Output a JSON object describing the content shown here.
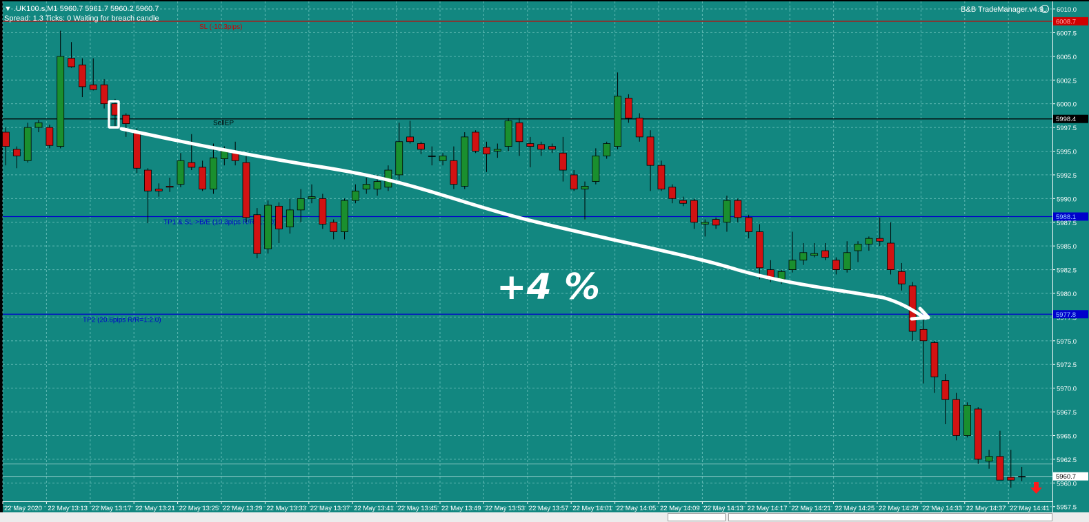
{
  "header": {
    "symbol_line": ".UK100.s,M1  5960.7 5961.7 5960.2 5960.7",
    "status_line": "Spread: 1.3   Ticks: 0   Waiting for breach candle",
    "trade_manager": "B&B TradeManager.v4.9"
  },
  "colors": {
    "background": "#128780",
    "grid": "#5fb9b3",
    "bull_candle": "#1a8f2e",
    "bear_candle": "#d21212",
    "stop_loss_line": "#d00000",
    "target_line": "#0000cc",
    "entry_line": "#000000"
  },
  "annotation": {
    "text": "+4 %",
    "arrow": "white hand-drawn arrow"
  },
  "chart_data": {
    "type": "candlestick",
    "title": ".UK100.s,M1",
    "ylim": [
      5956.9,
      6010.8
    ],
    "ytick_labels": [
      "6010.0",
      "6007.5",
      "6005.0",
      "6002.5",
      "6000.0",
      "5997.5",
      "5995.0",
      "5992.5",
      "5990.0",
      "5987.5",
      "5985.0",
      "5982.5",
      "5980.0",
      "5977.5",
      "5975.0",
      "5972.5",
      "5970.0",
      "5967.5",
      "5965.0",
      "5962.5",
      "5960.0",
      "5957.5"
    ],
    "xtick_labels": [
      "22 May 2020",
      "22 May 13:13",
      "22 May 13:17",
      "22 May 13:21",
      "22 May 13:25",
      "22 May 13:29",
      "22 May 13:33",
      "22 May 13:37",
      "22 May 13:41",
      "22 May 13:45",
      "22 May 13:49",
      "22 May 13:53",
      "22 May 13:57",
      "22 May 14:01",
      "22 May 14:05",
      "22 May 14:09",
      "22 May 14:13",
      "22 May 14:17",
      "22 May 14:21",
      "22 May 14:25",
      "22 May 14:29",
      "22 May 14:33",
      "22 May 14:37",
      "22 May 14:41"
    ],
    "levels": [
      {
        "label": "SL (-10.3pips)",
        "price": 6008.7,
        "tag": "6008.7",
        "role": "stop_loss"
      },
      {
        "label": "SellEP",
        "price": 5998.4,
        "tag": "5998.4",
        "role": "entry"
      },
      {
        "label": "TP1 & SL->B/E (10.3pips R/R=1:1.0)",
        "price": 5988.1,
        "tag": "5988.1",
        "role": "tp1"
      },
      {
        "label": "TP2 (20.6pips R/R=1:2.0)",
        "price": 5977.8,
        "tag": "5977.8",
        "role": "tp2"
      }
    ],
    "bid_price": {
      "price": 5960.7,
      "tag": "5960.7"
    },
    "extra_price_line": 5962.0,
    "candles": [
      {
        "o": 5997.0,
        "h": 5997.5,
        "l": 5993.5,
        "c": 5995.5
      },
      {
        "o": 5995.2,
        "h": 5995.5,
        "l": 5993.2,
        "c": 5994.5
      },
      {
        "o": 5994.0,
        "h": 5998.0,
        "l": 5993.8,
        "c": 5997.5
      },
      {
        "o": 5997.5,
        "h": 5998.3,
        "l": 5997.0,
        "c": 5998.0
      },
      {
        "o": 5997.5,
        "h": 5997.8,
        "l": 5995.3,
        "c": 5995.6
      },
      {
        "o": 5995.5,
        "h": 6007.7,
        "l": 5995.3,
        "c": 6005.0
      },
      {
        "o": 6004.8,
        "h": 6006.5,
        "l": 6003.8,
        "c": 6003.9
      },
      {
        "o": 6004.1,
        "h": 6004.8,
        "l": 6000.7,
        "c": 6001.8
      },
      {
        "o": 6002.0,
        "h": 6004.8,
        "l": 6001.4,
        "c": 6001.5
      },
      {
        "o": 6002.0,
        "h": 6002.6,
        "l": 5999.5,
        "c": 6000.0
      },
      {
        "o": 6000.0,
        "h": 6000.5,
        "l": 5997.5,
        "c": 5998.8
      },
      {
        "o": 5998.8,
        "h": 5999.0,
        "l": 5996.5,
        "c": 5997.9
      },
      {
        "o": 5997.0,
        "h": 5997.4,
        "l": 5992.7,
        "c": 5993.2
      },
      {
        "o": 5993.0,
        "h": 5993.2,
        "l": 5987.4,
        "c": 5990.8
      },
      {
        "o": 5991.0,
        "h": 5991.6,
        "l": 5990.2,
        "c": 5990.8
      },
      {
        "o": 5991.3,
        "h": 5992.2,
        "l": 5990.7,
        "c": 5991.2
      },
      {
        "o": 5991.5,
        "h": 5994.8,
        "l": 5991.2,
        "c": 5994.0
      },
      {
        "o": 5993.8,
        "h": 5996.8,
        "l": 5993.0,
        "c": 5993.3
      },
      {
        "o": 5993.3,
        "h": 5994.0,
        "l": 5990.8,
        "c": 5991.0
      },
      {
        "o": 5991.0,
        "h": 5995.8,
        "l": 5990.5,
        "c": 5994.3
      },
      {
        "o": 5994.2,
        "h": 5995.5,
        "l": 5993.5,
        "c": 5995.0
      },
      {
        "o": 5995.0,
        "h": 5996.0,
        "l": 5993.5,
        "c": 5994.0
      },
      {
        "o": 5993.8,
        "h": 5994.5,
        "l": 5987.5,
        "c": 5988.0
      },
      {
        "o": 5988.3,
        "h": 5989.0,
        "l": 5983.7,
        "c": 5984.2
      },
      {
        "o": 5984.7,
        "h": 5989.8,
        "l": 5984.2,
        "c": 5989.3
      },
      {
        "o": 5989.2,
        "h": 5989.6,
        "l": 5985.3,
        "c": 5986.8
      },
      {
        "o": 5987.0,
        "h": 5990.0,
        "l": 5986.3,
        "c": 5988.8
      },
      {
        "o": 5988.8,
        "h": 5991.0,
        "l": 5987.5,
        "c": 5990.0
      },
      {
        "o": 5990.0,
        "h": 5991.5,
        "l": 5989.5,
        "c": 5990.2
      },
      {
        "o": 5990.0,
        "h": 5990.5,
        "l": 5986.8,
        "c": 5987.3
      },
      {
        "o": 5987.5,
        "h": 5987.8,
        "l": 5985.7,
        "c": 5986.5
      },
      {
        "o": 5986.5,
        "h": 5990.0,
        "l": 5985.7,
        "c": 5989.8
      },
      {
        "o": 5989.8,
        "h": 5991.5,
        "l": 5989.5,
        "c": 5990.8
      },
      {
        "o": 5991.0,
        "h": 5992.2,
        "l": 5990.5,
        "c": 5991.5
      },
      {
        "o": 5991.0,
        "h": 5992.5,
        "l": 5990.3,
        "c": 5991.8
      },
      {
        "o": 5991.2,
        "h": 5993.5,
        "l": 5990.8,
        "c": 5993.0
      },
      {
        "o": 5992.5,
        "h": 5998.0,
        "l": 5992.0,
        "c": 5996.0
      },
      {
        "o": 5996.5,
        "h": 5998.2,
        "l": 5995.8,
        "c": 5996.0
      },
      {
        "o": 5995.8,
        "h": 5996.0,
        "l": 5994.7,
        "c": 5995.2
      },
      {
        "o": 5994.5,
        "h": 5995.5,
        "l": 5993.5,
        "c": 5994.5
      },
      {
        "o": 5994.0,
        "h": 5994.8,
        "l": 5993.5,
        "c": 5994.5
      },
      {
        "o": 5994.0,
        "h": 5995.5,
        "l": 5991.0,
        "c": 5991.5
      },
      {
        "o": 5991.3,
        "h": 5997.0,
        "l": 5991.0,
        "c": 5996.5
      },
      {
        "o": 5997.0,
        "h": 5997.2,
        "l": 5994.8,
        "c": 5995.0
      },
      {
        "o": 5995.4,
        "h": 5996.0,
        "l": 5992.8,
        "c": 5994.7
      },
      {
        "o": 5995.0,
        "h": 5995.8,
        "l": 5994.3,
        "c": 5995.2
      },
      {
        "o": 5995.5,
        "h": 5998.5,
        "l": 5995.0,
        "c": 5998.2
      },
      {
        "o": 5998.0,
        "h": 5998.5,
        "l": 5994.5,
        "c": 5996.0
      },
      {
        "o": 5995.8,
        "h": 5996.5,
        "l": 5993.3,
        "c": 5995.5
      },
      {
        "o": 5995.7,
        "h": 5996.0,
        "l": 5994.5,
        "c": 5995.2
      },
      {
        "o": 5995.5,
        "h": 5995.8,
        "l": 5994.8,
        "c": 5995.2
      },
      {
        "o": 5994.8,
        "h": 5996.5,
        "l": 5991.8,
        "c": 5993.0
      },
      {
        "o": 5992.5,
        "h": 5993.0,
        "l": 5990.8,
        "c": 5991.0
      },
      {
        "o": 5991.0,
        "h": 5991.8,
        "l": 5987.8,
        "c": 5991.3
      },
      {
        "o": 5991.8,
        "h": 5995.3,
        "l": 5991.5,
        "c": 5994.5
      },
      {
        "o": 5994.5,
        "h": 5996.0,
        "l": 5994.2,
        "c": 5995.8
      },
      {
        "o": 5995.5,
        "h": 6003.3,
        "l": 5995.2,
        "c": 6000.8
      },
      {
        "o": 6000.6,
        "h": 6001.0,
        "l": 5998.0,
        "c": 5998.5
      },
      {
        "o": 5998.5,
        "h": 5999.0,
        "l": 5996.0,
        "c": 5996.5
      },
      {
        "o": 5996.5,
        "h": 5997.2,
        "l": 5990.8,
        "c": 5993.5
      },
      {
        "o": 5993.5,
        "h": 5994.0,
        "l": 5990.8,
        "c": 5991.0
      },
      {
        "o": 5991.2,
        "h": 5991.5,
        "l": 5989.5,
        "c": 5990.0
      },
      {
        "o": 5989.8,
        "h": 5990.2,
        "l": 5989.2,
        "c": 5989.5
      },
      {
        "o": 5989.8,
        "h": 5990.0,
        "l": 5986.8,
        "c": 5987.5
      },
      {
        "o": 5987.3,
        "h": 5987.8,
        "l": 5986.0,
        "c": 5987.5
      },
      {
        "o": 5987.8,
        "h": 5988.0,
        "l": 5986.8,
        "c": 5987.2
      },
      {
        "o": 5987.5,
        "h": 5990.3,
        "l": 5986.5,
        "c": 5989.8
      },
      {
        "o": 5989.8,
        "h": 5990.0,
        "l": 5987.5,
        "c": 5988.0
      },
      {
        "o": 5988.0,
        "h": 5988.3,
        "l": 5985.8,
        "c": 5986.5
      },
      {
        "o": 5986.5,
        "h": 5987.3,
        "l": 5981.5,
        "c": 5982.7
      },
      {
        "o": 5982.5,
        "h": 5983.5,
        "l": 5981.2,
        "c": 5981.5
      },
      {
        "o": 5981.5,
        "h": 5982.5,
        "l": 5981.0,
        "c": 5982.3
      },
      {
        "o": 5982.5,
        "h": 5986.5,
        "l": 5982.2,
        "c": 5983.5
      },
      {
        "o": 5983.5,
        "h": 5985.3,
        "l": 5983.0,
        "c": 5984.3
      },
      {
        "o": 5984.0,
        "h": 5985.3,
        "l": 5983.8,
        "c": 5984.2
      },
      {
        "o": 5984.5,
        "h": 5985.3,
        "l": 5983.5,
        "c": 5983.8
      },
      {
        "o": 5983.5,
        "h": 5983.8,
        "l": 5982.0,
        "c": 5982.5
      },
      {
        "o": 5982.5,
        "h": 5985.5,
        "l": 5982.2,
        "c": 5984.3
      },
      {
        "o": 5984.5,
        "h": 5985.5,
        "l": 5983.3,
        "c": 5985.2
      },
      {
        "o": 5985.2,
        "h": 5986.0,
        "l": 5984.5,
        "c": 5985.8
      },
      {
        "o": 5985.8,
        "h": 5988.0,
        "l": 5985.0,
        "c": 5985.5
      },
      {
        "o": 5985.3,
        "h": 5987.5,
        "l": 5982.0,
        "c": 5982.5
      },
      {
        "o": 5982.3,
        "h": 5983.2,
        "l": 5980.3,
        "c": 5981.0
      },
      {
        "o": 5980.8,
        "h": 5981.2,
        "l": 5975.0,
        "c": 5976.0
      },
      {
        "o": 5976.2,
        "h": 5977.5,
        "l": 5970.5,
        "c": 5975.0
      },
      {
        "o": 5974.8,
        "h": 5975.0,
        "l": 5969.5,
        "c": 5971.2
      },
      {
        "o": 5970.8,
        "h": 5971.5,
        "l": 5966.2,
        "c": 5968.8
      },
      {
        "o": 5968.8,
        "h": 5969.5,
        "l": 5964.5,
        "c": 5965.0
      },
      {
        "o": 5965.0,
        "h": 5968.5,
        "l": 5964.8,
        "c": 5968.2
      },
      {
        "o": 5967.8,
        "h": 5968.0,
        "l": 5962.0,
        "c": 5962.5
      },
      {
        "o": 5962.3,
        "h": 5963.5,
        "l": 5961.5,
        "c": 5962.8
      },
      {
        "o": 5962.8,
        "h": 5965.5,
        "l": 5960.8,
        "c": 5960.3
      },
      {
        "o": 5960.6,
        "h": 5963.5,
        "l": 5959.5,
        "c": 5960.3
      },
      {
        "o": 5960.7,
        "h": 5961.7,
        "l": 5960.2,
        "c": 5960.7
      }
    ]
  }
}
